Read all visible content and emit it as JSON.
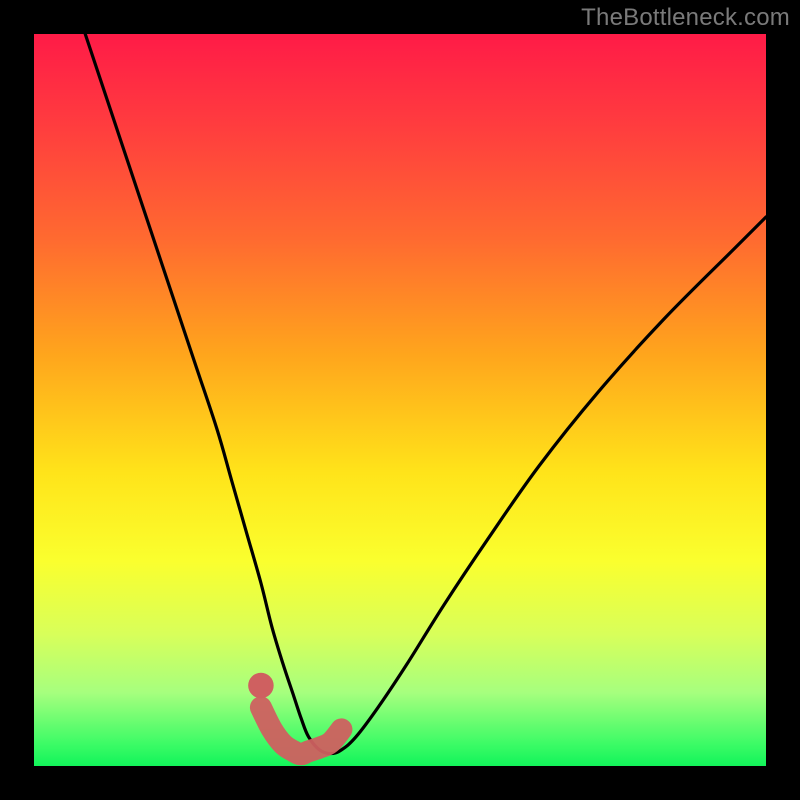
{
  "watermark": "TheBottleneck.com",
  "chart_data": {
    "type": "line",
    "title": "",
    "xlabel": "",
    "ylabel": "",
    "xlim": [
      0,
      100
    ],
    "ylim": [
      0,
      100
    ],
    "grid": false,
    "series": [
      {
        "name": "bottleneck-curve",
        "x": [
          7,
          10,
          13,
          16,
          19,
          22,
          25,
          27,
          29,
          31,
          32.5,
          34,
          35.5,
          36.5,
          37.5,
          39,
          40.5,
          42,
          44,
          47,
          51,
          56,
          62,
          69,
          77,
          86,
          96,
          100
        ],
        "y": [
          100,
          91,
          82,
          73,
          64,
          55,
          46,
          39,
          32,
          25,
          19,
          14,
          9.5,
          6.5,
          4,
          2.2,
          1.7,
          2.2,
          4,
          8,
          14,
          22,
          31,
          41,
          51,
          61,
          71,
          75
        ]
      },
      {
        "name": "highlight-band",
        "x": [
          31,
          32.5,
          34,
          35.5,
          36.5,
          37.5,
          39,
          40.5,
          42
        ],
        "y": [
          8,
          5,
          3,
          2,
          1.6,
          2,
          2.5,
          3.2,
          5
        ]
      }
    ],
    "colors": {
      "curve": "#000000",
      "highlight": "#cf6060",
      "marker": "#cf6060",
      "gradient_top": "#ff1b47",
      "gradient_bottom": "#12f45a"
    },
    "marker": {
      "x": 31,
      "y": 11,
      "r": 1.3
    }
  }
}
